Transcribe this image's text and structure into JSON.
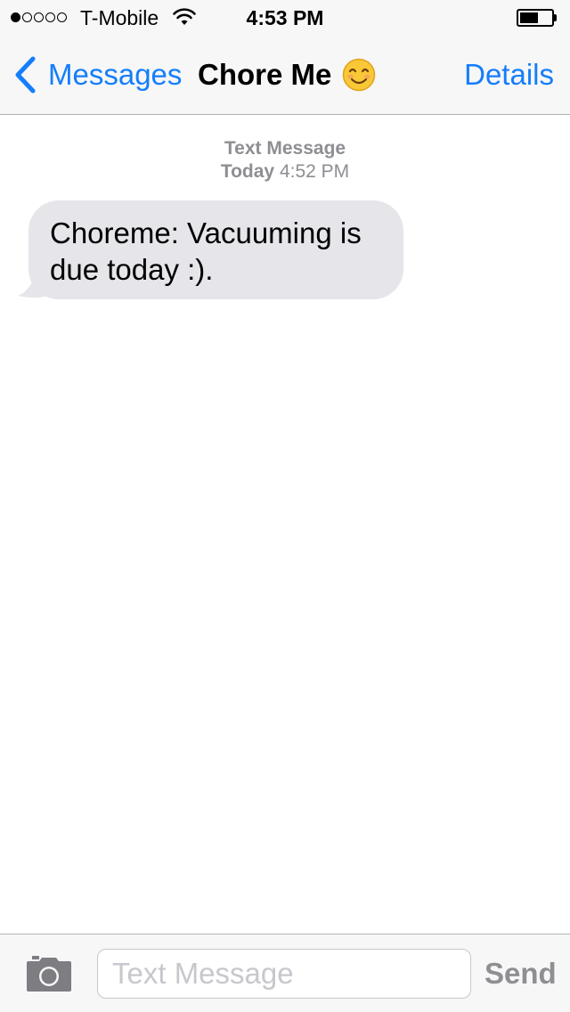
{
  "status_bar": {
    "signal_bars_filled": 1,
    "signal_bars_total": 5,
    "carrier": "T-Mobile",
    "wifi_icon": "wifi-icon",
    "time": "4:53 PM",
    "battery_level": 0.6,
    "battery_icon": "battery-icon"
  },
  "nav": {
    "back_label": "Messages",
    "back_icon": "chevron-left-icon",
    "title": "Chore Me",
    "title_emoji": "smiling-face-icon",
    "details_label": "Details",
    "accent_color": "#157efb"
  },
  "conversation": {
    "timestamp_type": "Text Message",
    "timestamp_day": "Today",
    "timestamp_time": "4:52 PM",
    "messages": [
      {
        "direction": "incoming",
        "text": "Choreme: Vacuuming is due today :).",
        "bubble_color": "#e5e5ea"
      }
    ]
  },
  "input_bar": {
    "camera_icon": "camera-icon",
    "placeholder": "Text Message",
    "value": "",
    "send_label": "Send"
  }
}
